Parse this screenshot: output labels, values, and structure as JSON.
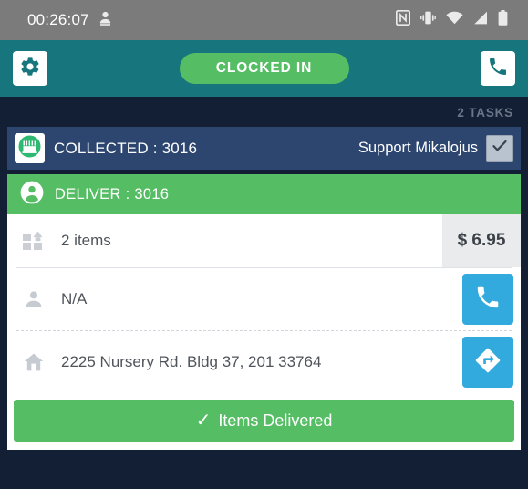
{
  "statusbar": {
    "time": "00:26:07",
    "left_icon": "user-upload-icon",
    "icons": [
      "nfc-icon",
      "vibrate-icon",
      "wifi-icon",
      "cell-signal-icon",
      "battery-icon"
    ]
  },
  "header": {
    "settings_icon": "gear-icon",
    "status_label": "CLOCKED IN",
    "phone_icon": "phone-icon",
    "background_color": "#17757d",
    "status_color": "#55bd63"
  },
  "tasks": {
    "count_label": "2 TASKS"
  },
  "collected": {
    "icon": "store-icon",
    "label": "COLLECTED : 3016",
    "support_name": "Support Mikalojus",
    "checkbox_checked": true,
    "background_color": "#2d4670"
  },
  "deliver": {
    "icon": "person-icon",
    "label": "DELIVER : 3016",
    "background_color": "#55bd63"
  },
  "rows": [
    {
      "icon": "items-grid-icon",
      "text": "2 items",
      "price": "$ 6.95"
    },
    {
      "icon": "person-outline-icon",
      "text": "N/A",
      "action_icon": "phone-icon",
      "action_color": "#33aadd"
    },
    {
      "icon": "home-icon",
      "text": "2225 Nursery Rd. Bldg 37, 201 33764",
      "action_icon": "directions-icon",
      "action_color": "#33aadd"
    }
  ],
  "primary_action": {
    "check_glyph": "✓",
    "label": "Items Delivered",
    "color": "#55bd63"
  }
}
